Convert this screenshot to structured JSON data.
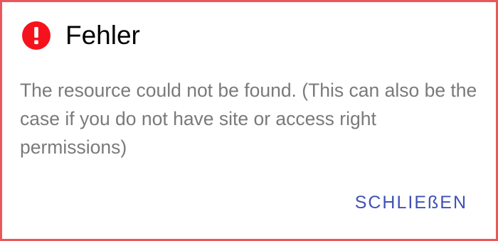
{
  "dialog": {
    "title": "Fehler",
    "icon": "alert-circle-icon",
    "message": "The resource could not be found. (This can also be the case if you do not have site or access right permissions)",
    "close_label": "SCHLIEßEN"
  },
  "colors": {
    "border": "#e9575a",
    "icon": "#f5121c",
    "message_text": "#7a7a7a",
    "button_text": "#3f51b5"
  }
}
